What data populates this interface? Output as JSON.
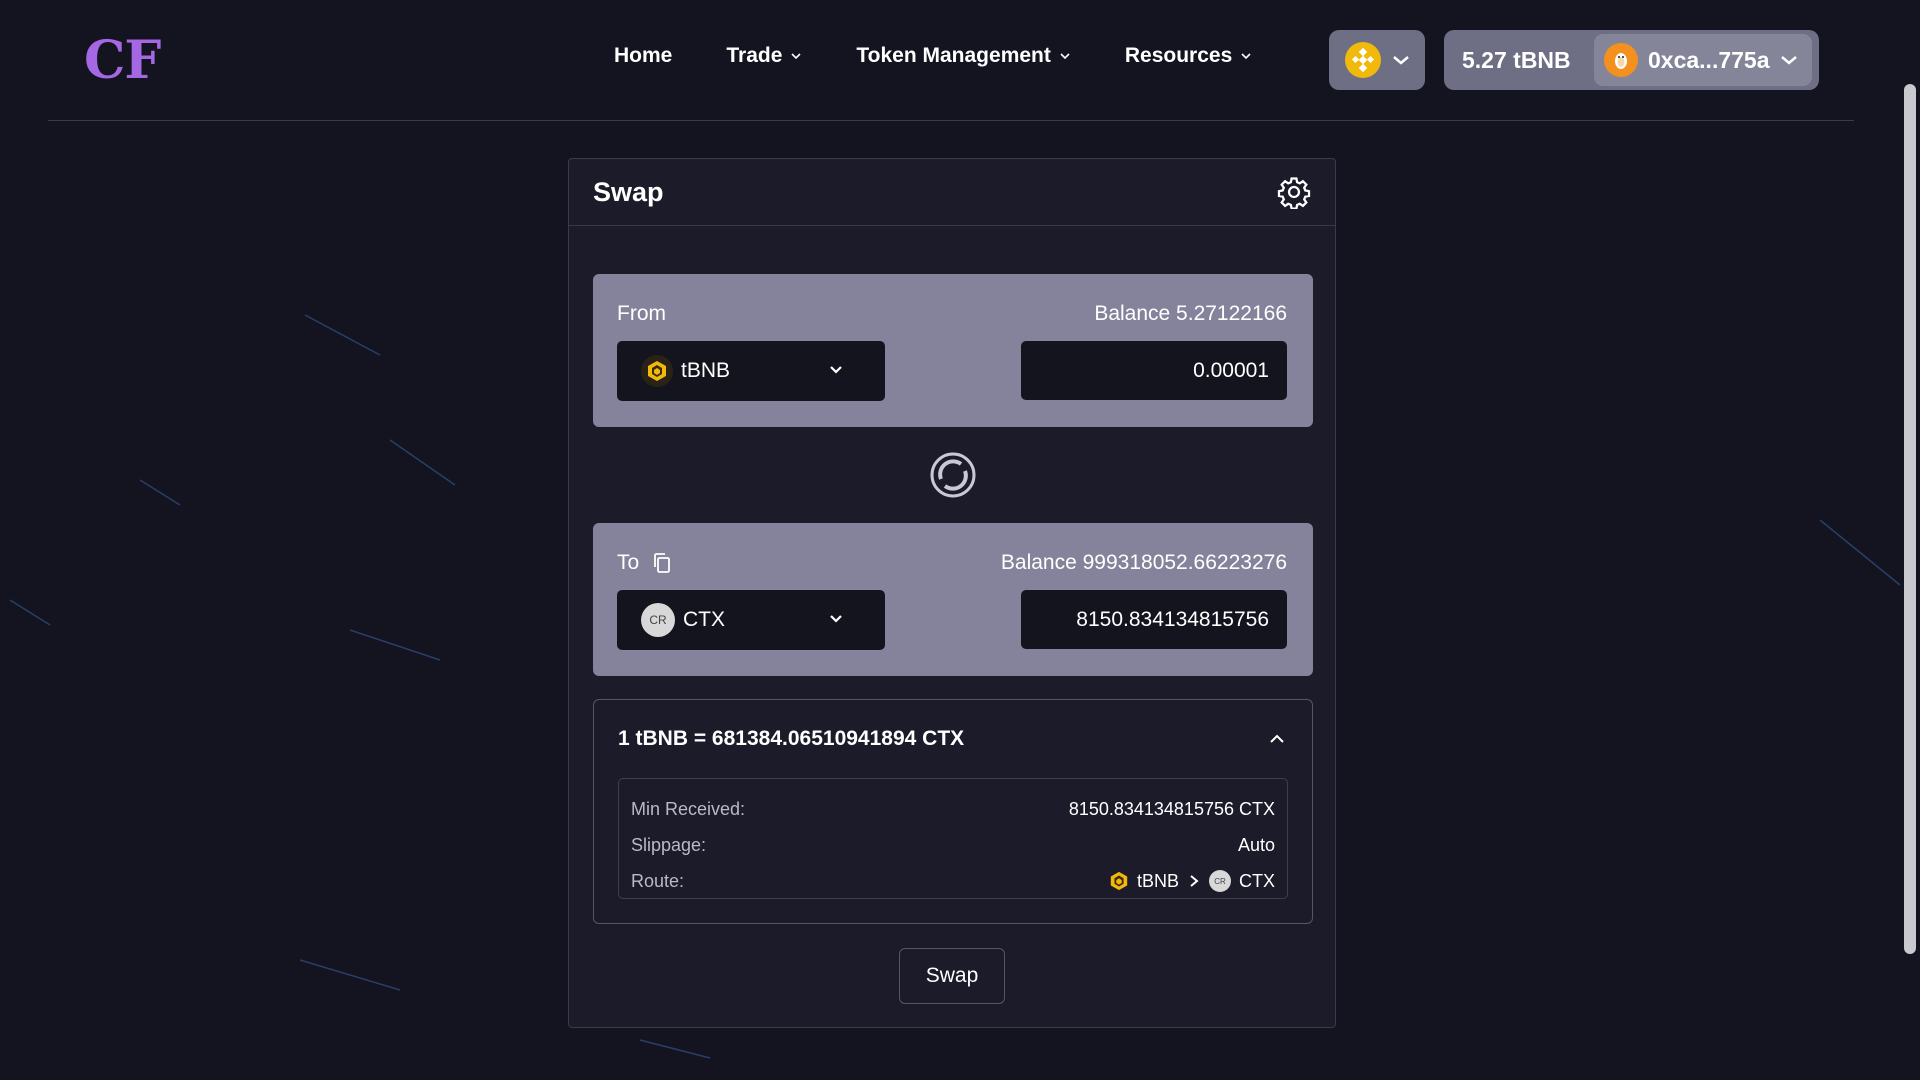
{
  "app": {
    "logo": "CF"
  },
  "nav": {
    "items": [
      {
        "label": "Home"
      },
      {
        "label": "Trade"
      },
      {
        "label": "Token Management"
      },
      {
        "label": "Resources"
      }
    ]
  },
  "wallet": {
    "balance": "5.27 tBNB",
    "address": "0xca...775a"
  },
  "swap": {
    "title": "Swap",
    "from": {
      "label": "From",
      "balance": "Balance 5.27122166",
      "token": "tBNB",
      "amount": "0.00001"
    },
    "to": {
      "label": "To",
      "balance": "Balance 999318052.66223276",
      "token": "CTX",
      "token_icon_text": "CR",
      "amount": "8150.834134815756"
    },
    "rate": "1 tBNB = 681384.06510941894 CTX",
    "details": {
      "min_received_label": "Min Received:",
      "min_received_value": "8150.834134815756 CTX",
      "slippage_label": "Slippage:",
      "slippage_value": "Auto",
      "route_label": "Route:",
      "route_from": "tBNB",
      "route_to": "CTX",
      "route_to_icon_text": "CR"
    },
    "button_label": "Swap"
  },
  "colors": {
    "background": "#141420",
    "card": "#1b1b2a",
    "panel": "#85839b",
    "logo": "#a667e4",
    "bnb": "#f0b90b"
  }
}
